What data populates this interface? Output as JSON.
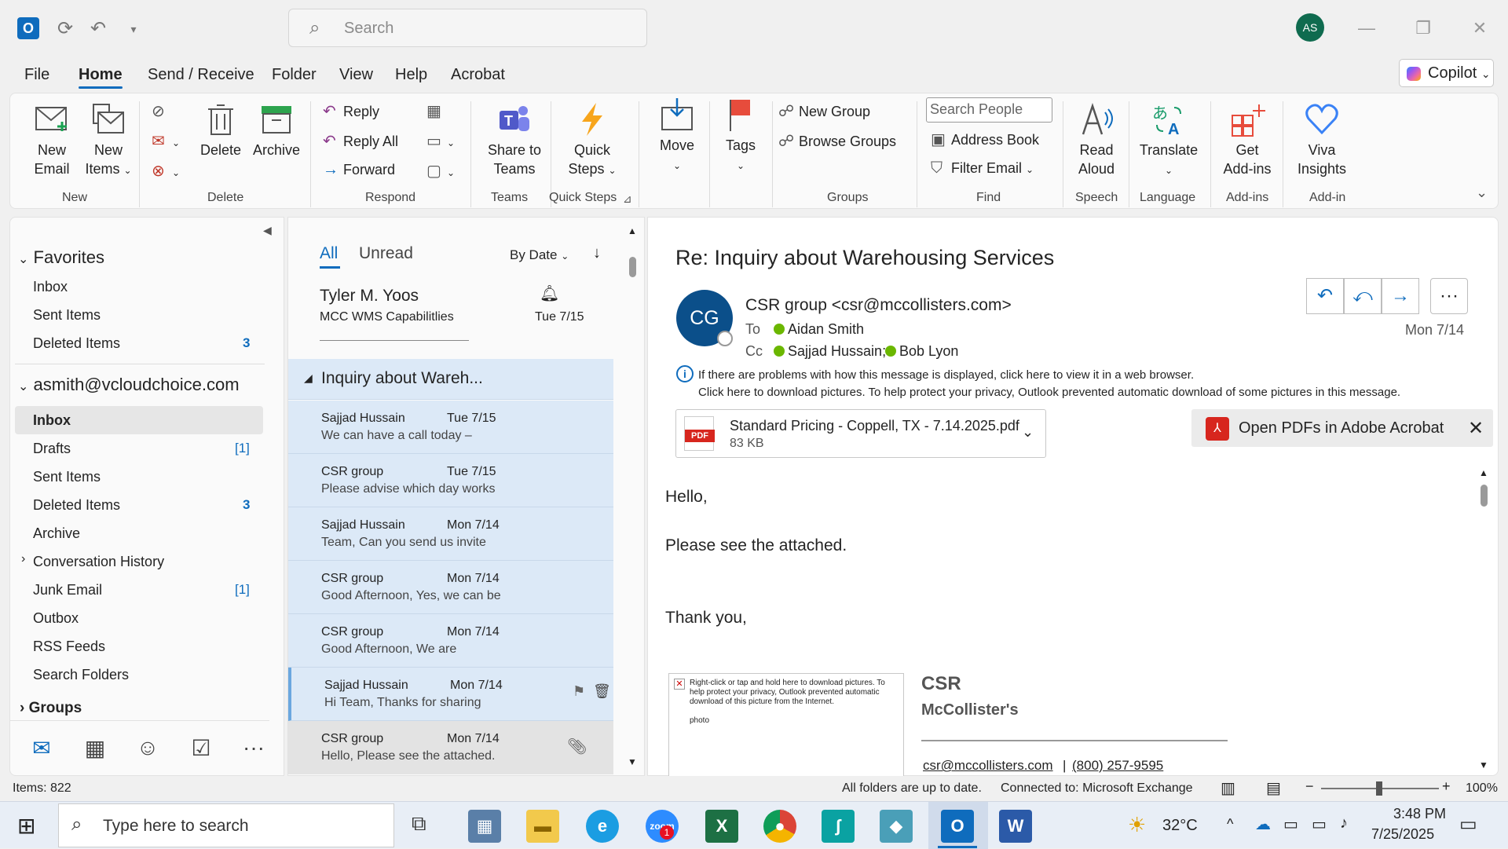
{
  "titlebar": {
    "search_placeholder": "Search",
    "avatar_initials": "AS"
  },
  "menu": {
    "file": "File",
    "home": "Home",
    "send_receive": "Send / Receive",
    "folder": "Folder",
    "view": "View",
    "help": "Help",
    "acrobat": "Acrobat",
    "copilot": "Copilot"
  },
  "ribbon": {
    "new_email": [
      "New",
      "Email"
    ],
    "new_items": [
      "New",
      "Items"
    ],
    "delete": "Delete",
    "archive": "Archive",
    "reply": "Reply",
    "reply_all": "Reply All",
    "forward": "Forward",
    "share_teams": [
      "Share to",
      "Teams"
    ],
    "quick_steps": [
      "Quick",
      "Steps"
    ],
    "move": "Move",
    "tags": "Tags",
    "new_group": "New Group",
    "browse_groups": "Browse Groups",
    "search_people": "Search People",
    "address_book": "Address Book",
    "filter_email": "Filter Email",
    "read_aloud": [
      "Read",
      "Aloud"
    ],
    "translate": "Translate",
    "get_addins": [
      "Get",
      "Add-ins"
    ],
    "viva": [
      "Viva",
      "Insights"
    ],
    "groups": {
      "new": "New",
      "delete": "Delete",
      "respond": "Respond",
      "teams": "Teams",
      "quick_steps": "Quick Steps",
      "groups": "Groups",
      "find": "Find",
      "speech": "Speech",
      "language": "Language",
      "addins": "Add-ins",
      "addin": "Add-in"
    }
  },
  "folders": {
    "favorites": "Favorites",
    "fav_items": [
      {
        "label": "Inbox",
        "badge": ""
      },
      {
        "label": "Sent Items",
        "badge": ""
      },
      {
        "label": "Deleted Items",
        "badge": "3"
      }
    ],
    "account": "asmith@vcloudchoice.com",
    "items": [
      {
        "label": "Inbox",
        "badge": ""
      },
      {
        "label": "Drafts",
        "badge": "[1]"
      },
      {
        "label": "Sent Items",
        "badge": ""
      },
      {
        "label": "Deleted Items",
        "badge": "3"
      },
      {
        "label": "Archive",
        "badge": ""
      },
      {
        "label": "Conversation History",
        "badge": ""
      },
      {
        "label": "Junk Email",
        "badge": "[1]"
      },
      {
        "label": "Outbox",
        "badge": ""
      },
      {
        "label": "RSS Feeds",
        "badge": ""
      },
      {
        "label": "Search Folders",
        "badge": ""
      }
    ],
    "groups": "Groups"
  },
  "list": {
    "tab_all": "All",
    "tab_unread": "Unread",
    "sort": "By Date",
    "first": {
      "from": "Tyler M. Yoos",
      "subject": "MCC WMS Capabilitlies",
      "date": "Tue 7/15"
    },
    "thread_title": "Inquiry about Wareh...",
    "messages": [
      {
        "from": "Sajjad Hussain",
        "date": "Tue 7/15",
        "preview": "We can have a call today –"
      },
      {
        "from": "CSR group",
        "date": "Tue 7/15",
        "preview": "Please advise which day works"
      },
      {
        "from": "Sajjad Hussain",
        "date": "Mon 7/14",
        "preview": "Team,  Can you send us invite"
      },
      {
        "from": "CSR group",
        "date": "Mon 7/14",
        "preview": "Good Afternoon,  Yes, we can be"
      },
      {
        "from": "CSR group",
        "date": "Mon 7/14",
        "preview": "Good Afternoon,  We are"
      },
      {
        "from": "Sajjad Hussain",
        "date": "Mon 7/14",
        "preview": "Hi Team,   Thanks for sharing"
      },
      {
        "from": "CSR group",
        "date": "Mon 7/14",
        "preview": "Hello,  Please see the attached."
      }
    ]
  },
  "reading": {
    "subject": "Re: Inquiry about Warehousing Services",
    "avatar": "CG",
    "from": "CSR group <csr@mccollisters.com>",
    "to_label": "To",
    "to": "Aidan Smith",
    "cc_label": "Cc",
    "cc1": "Sajjad Hussain;",
    "cc2": "Bob Lyon",
    "date": "Mon 7/14",
    "info1": "If there are problems with how this message is displayed, click here to view it in a web browser.",
    "info2": "Click here to download pictures. To help protect your privacy, Outlook prevented automatic download of some pictures in this message.",
    "attachment_name": "Standard Pricing - Coppell, TX - 7.14.2025.pdf",
    "attachment_size": "83 KB",
    "pdf_label": "PDF",
    "acrobat_bar": "Open PDFs in Adobe Acrobat",
    "body1": "Hello,",
    "body2": "Please see the attached.",
    "body3": "Thank you,",
    "img_placeholder": "Right-click or tap and hold here to download pictures. To help protect your privacy, Outlook prevented automatic download of this picture from the Internet.",
    "img_alt": "photo",
    "sig1": "CSR",
    "sig2": "McCollister's",
    "sig_email": "csr@mccollisters.com",
    "sig_sep": "|",
    "sig_phone": "(800) 257-9595"
  },
  "status": {
    "items": "Items: 822",
    "uptodate": "All folders are up to date.",
    "connected": "Connected to: Microsoft Exchange",
    "zoom": "100%"
  },
  "taskbar": {
    "search_placeholder": "Type here to search",
    "temp": "32°C",
    "time": "3:48 PM",
    "date": "7/25/2025",
    "zoom_badge": "1"
  }
}
